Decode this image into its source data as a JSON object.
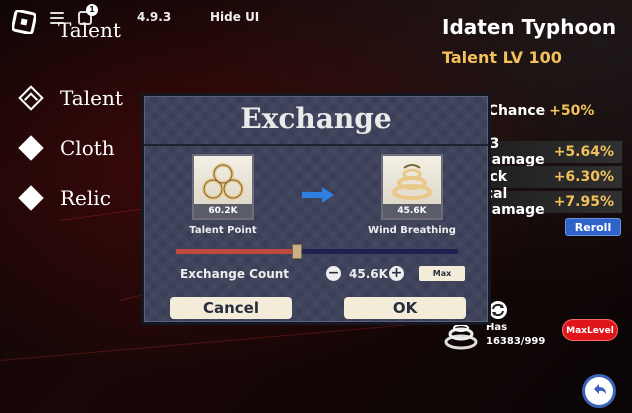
{
  "topbar": {
    "notification_count": "1",
    "version": "4.9.3",
    "hide_ui_label": "Hide UI",
    "partial_title": "Talent"
  },
  "nav": {
    "items": [
      {
        "label": "Talent",
        "active": true
      },
      {
        "label": "Cloth",
        "active": false
      },
      {
        "label": "Relic",
        "active": false
      }
    ]
  },
  "character": {
    "name": "Idaten Typhoon",
    "talent_level": "Talent LV 100"
  },
  "stats": {
    "chance": {
      "label": "l Chance",
      "value": "+50%"
    },
    "rows": [
      {
        "label": "ll3 Damage",
        "value": "+5.64%"
      },
      {
        "label": "ack",
        "value": "+6.30%"
      },
      {
        "label": "ical Damage",
        "value": "+7.95%"
      }
    ],
    "reroll_label": "Reroll"
  },
  "inventory": {
    "has_label": "Has",
    "has_count": "16383/999",
    "maxlevel_label": "MaxLevel"
  },
  "modal": {
    "title": "Exchange",
    "from": {
      "amount": "60.2K",
      "label": "Talent Point",
      "icon": "talent-point-icon"
    },
    "to": {
      "amount": "45.6K",
      "label": "Wind Breathing",
      "icon": "wind-breathing-icon"
    },
    "slider_fraction": 0.43,
    "count_label": "Exchange Count",
    "count_value": "45.6K",
    "minus_symbol": "−",
    "plus_symbol": "+",
    "max_label": "Max",
    "cancel_label": "Cancel",
    "ok_label": "OK"
  },
  "colors": {
    "accent_gold": "#f2c15a",
    "reroll_blue": "#2f63c9",
    "maxlevel_red": "#e0151a",
    "modal_bg": "#3a3f57",
    "slider_fill": "#c0483e",
    "slider_track": "#1d2250"
  }
}
